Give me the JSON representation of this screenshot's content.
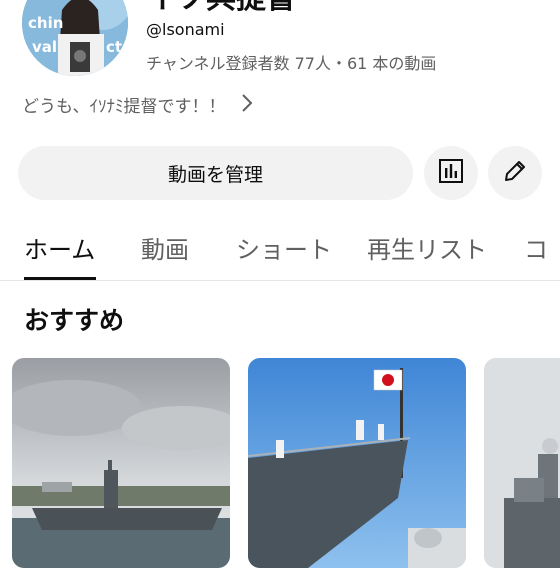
{
  "channel": {
    "title": "イソ兵提督",
    "handle": "@lsonami",
    "stats": "チャンネル登録者数 77人・61 本の動画",
    "description": "どうも、ｲｿﾅﾐ提督です！！",
    "avatar_text_1": "chin",
    "avatar_text_2": "val",
    "avatar_text_3": "ct"
  },
  "actions": {
    "manage_label": "動画を管理"
  },
  "tabs": [
    {
      "label": "ホーム",
      "active": true
    },
    {
      "label": "動画",
      "active": false
    },
    {
      "label": "ショート",
      "active": false
    },
    {
      "label": "再生リスト",
      "active": false
    },
    {
      "label": "コ",
      "active": false
    }
  ],
  "sections": {
    "recommended_title": "おすすめ"
  },
  "icons": {
    "analytics": "bar-chart-icon",
    "edit": "pencil-icon",
    "description_more": "chevron-right-icon"
  },
  "colors": {
    "button_bg": "#f2f2f2",
    "text_primary": "#0f0f0f",
    "text_secondary": "#606060"
  }
}
